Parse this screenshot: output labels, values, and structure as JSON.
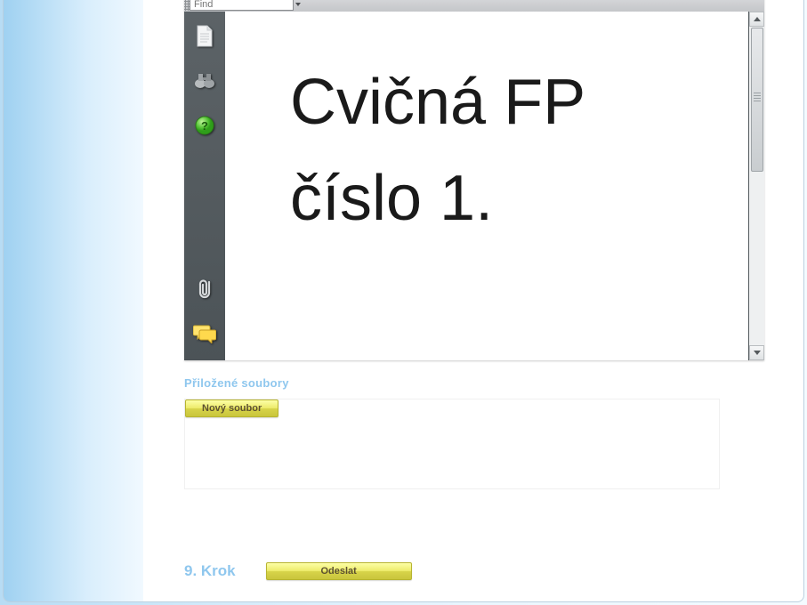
{
  "pdf": {
    "find_placeholder": "Find",
    "page_line1": "Cvičná FP",
    "page_line2": "číslo 1."
  },
  "attachments": {
    "heading": "Přiložené soubory",
    "new_file_btn": "Nový soubor"
  },
  "step": {
    "label": "9. Krok",
    "send_btn": "Odeslat"
  }
}
